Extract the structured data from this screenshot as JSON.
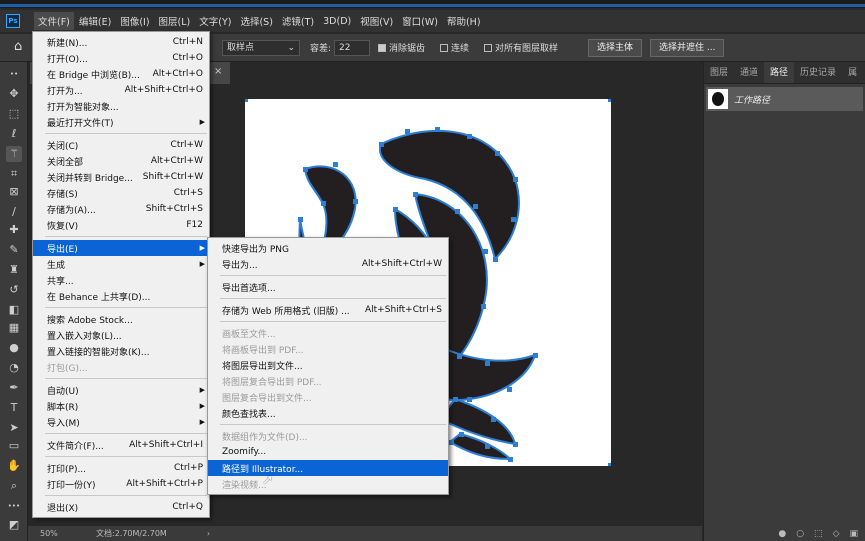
{
  "menubar": {
    "items": [
      "文件(F)",
      "编辑(E)",
      "图像(I)",
      "图层(L)",
      "文字(Y)",
      "选择(S)",
      "滤镜(T)",
      "3D(D)",
      "视图(V)",
      "窗口(W)",
      "帮助(H)"
    ]
  },
  "options": {
    "sample_value": "取样点",
    "tolerance_label": "容差:",
    "tolerance_value": "22",
    "antialias_label": "消除锯齿",
    "contiguous_label": "连续",
    "all_layers_label": "对所有图层取样",
    "select_subject": "选择主体",
    "select_mask": "选择并遮住 ..."
  },
  "doc_tab": {
    "close": "×"
  },
  "status": {
    "zoom": "50%",
    "doc": "文档:2.70M/2.70M"
  },
  "panel": {
    "tabs": [
      "图层",
      "通道",
      "路径",
      "历史记录",
      "属"
    ],
    "active_tab": "路径",
    "work_path": "工作路径",
    "bottom_icons": [
      "●",
      "○",
      "⬚",
      "◇",
      "▣"
    ]
  },
  "file_menu": [
    {
      "label": "新建(N)...",
      "sc": "Ctrl+N"
    },
    {
      "label": "打开(O)...",
      "sc": "Ctrl+O"
    },
    {
      "label": "在 Bridge 中浏览(B)...",
      "sc": "Alt+Ctrl+O"
    },
    {
      "label": "打开为...",
      "sc": "Alt+Shift+Ctrl+O"
    },
    {
      "label": "打开为智能对象...",
      "sc": ""
    },
    {
      "label": "最近打开文件(T)",
      "sc": "",
      "sub": true
    },
    {
      "sep": true
    },
    {
      "label": "关闭(C)",
      "sc": "Ctrl+W"
    },
    {
      "label": "关闭全部",
      "sc": "Alt+Ctrl+W"
    },
    {
      "label": "关闭并转到 Bridge...",
      "sc": "Shift+Ctrl+W"
    },
    {
      "label": "存储(S)",
      "sc": "Ctrl+S"
    },
    {
      "label": "存储为(A)...",
      "sc": "Shift+Ctrl+S"
    },
    {
      "label": "恢复(V)",
      "sc": "F12"
    },
    {
      "sep": true
    },
    {
      "label": "导出(E)",
      "sc": "",
      "sub": true,
      "hl": true
    },
    {
      "label": "生成",
      "sc": "",
      "sub": true
    },
    {
      "label": "共享...",
      "sc": ""
    },
    {
      "label": "在 Behance 上共享(D)...",
      "sc": ""
    },
    {
      "sep": true
    },
    {
      "label": "搜索 Adobe Stock...",
      "sc": ""
    },
    {
      "label": "置入嵌入对象(L)...",
      "sc": ""
    },
    {
      "label": "置入链接的智能对象(K)...",
      "sc": ""
    },
    {
      "label": "打包(G)...",
      "sc": "",
      "dis": true
    },
    {
      "sep": true
    },
    {
      "label": "自动(U)",
      "sc": "",
      "sub": true
    },
    {
      "label": "脚本(R)",
      "sc": "",
      "sub": true
    },
    {
      "label": "导入(M)",
      "sc": "",
      "sub": true
    },
    {
      "sep": true
    },
    {
      "label": "文件简介(F)...",
      "sc": "Alt+Shift+Ctrl+I"
    },
    {
      "sep": true
    },
    {
      "label": "打印(P)...",
      "sc": "Ctrl+P"
    },
    {
      "label": "打印一份(Y)",
      "sc": "Alt+Shift+Ctrl+P"
    },
    {
      "sep": true
    },
    {
      "label": "退出(X)",
      "sc": "Ctrl+Q"
    }
  ],
  "export_menu": [
    {
      "label": "快速导出为 PNG",
      "sc": ""
    },
    {
      "label": "导出为...",
      "sc": "Alt+Shift+Ctrl+W"
    },
    {
      "sep": true
    },
    {
      "label": "导出首选项...",
      "sc": ""
    },
    {
      "sep": true
    },
    {
      "label": "存储为 Web 所用格式 (旧版) ...",
      "sc": "Alt+Shift+Ctrl+S"
    },
    {
      "sep": true
    },
    {
      "label": "画板至文件...",
      "sc": "",
      "dis": true
    },
    {
      "label": "将画板导出到 PDF...",
      "sc": "",
      "dis": true
    },
    {
      "label": "将图层导出到文件...",
      "sc": ""
    },
    {
      "label": "将图层复合导出到 PDF...",
      "sc": "",
      "dis": true
    },
    {
      "label": "图层复合导出到文件...",
      "sc": "",
      "dis": true
    },
    {
      "label": "颜色查找表...",
      "sc": ""
    },
    {
      "sep": true
    },
    {
      "label": "数据组作为文件(D)...",
      "sc": "",
      "dis": true
    },
    {
      "label": "Zoomify...",
      "sc": ""
    },
    {
      "label": "路径到 Illustrator...",
      "sc": "",
      "hl": true
    },
    {
      "label": "渲染视频...",
      "sc": "",
      "dis": true
    }
  ]
}
